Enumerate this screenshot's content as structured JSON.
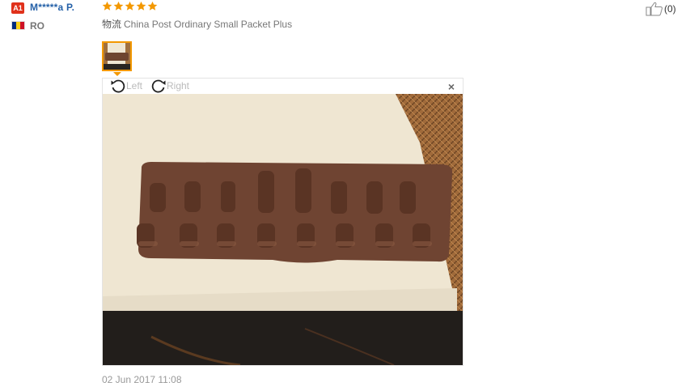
{
  "reviewer": {
    "level_badge": "A1",
    "name": "M*****a P.",
    "country_code": "RO",
    "flag_colors": [
      "#002b7f",
      "#fcd116",
      "#ce1126"
    ]
  },
  "review": {
    "rating": 5,
    "rating_max": 5,
    "star_color": "#f39800",
    "logistics_label": "物流",
    "logistics_value": "China Post Ordinary Small Packet Plus",
    "date": "02 Jun 2017 11:08"
  },
  "helpful": {
    "icon": "thumbs-up-icon",
    "count": "(0)"
  },
  "viewer": {
    "rotate_left_label": "Left",
    "rotate_right_label": "Right",
    "close_label": "×"
  }
}
